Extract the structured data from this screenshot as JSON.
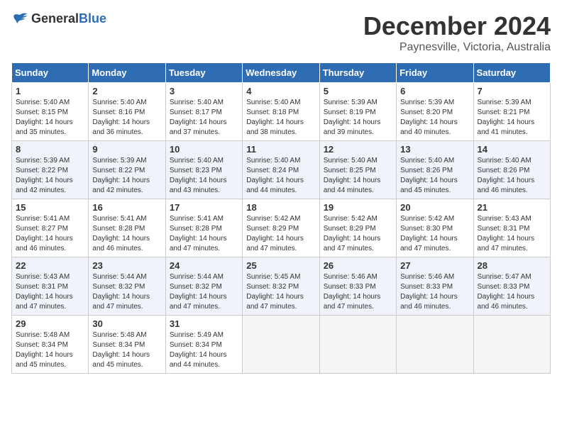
{
  "header": {
    "logo_general": "General",
    "logo_blue": "Blue",
    "month_title": "December 2024",
    "location": "Paynesville, Victoria, Australia"
  },
  "weekdays": [
    "Sunday",
    "Monday",
    "Tuesday",
    "Wednesday",
    "Thursday",
    "Friday",
    "Saturday"
  ],
  "weeks": [
    [
      {
        "day": "1",
        "sunrise": "5:40 AM",
        "sunset": "8:15 PM",
        "daylight": "14 hours and 35 minutes."
      },
      {
        "day": "2",
        "sunrise": "5:40 AM",
        "sunset": "8:16 PM",
        "daylight": "14 hours and 36 minutes."
      },
      {
        "day": "3",
        "sunrise": "5:40 AM",
        "sunset": "8:17 PM",
        "daylight": "14 hours and 37 minutes."
      },
      {
        "day": "4",
        "sunrise": "5:40 AM",
        "sunset": "8:18 PM",
        "daylight": "14 hours and 38 minutes."
      },
      {
        "day": "5",
        "sunrise": "5:39 AM",
        "sunset": "8:19 PM",
        "daylight": "14 hours and 39 minutes."
      },
      {
        "day": "6",
        "sunrise": "5:39 AM",
        "sunset": "8:20 PM",
        "daylight": "14 hours and 40 minutes."
      },
      {
        "day": "7",
        "sunrise": "5:39 AM",
        "sunset": "8:21 PM",
        "daylight": "14 hours and 41 minutes."
      }
    ],
    [
      {
        "day": "8",
        "sunrise": "5:39 AM",
        "sunset": "8:22 PM",
        "daylight": "14 hours and 42 minutes."
      },
      {
        "day": "9",
        "sunrise": "5:39 AM",
        "sunset": "8:22 PM",
        "daylight": "14 hours and 42 minutes."
      },
      {
        "day": "10",
        "sunrise": "5:40 AM",
        "sunset": "8:23 PM",
        "daylight": "14 hours and 43 minutes."
      },
      {
        "day": "11",
        "sunrise": "5:40 AM",
        "sunset": "8:24 PM",
        "daylight": "14 hours and 44 minutes."
      },
      {
        "day": "12",
        "sunrise": "5:40 AM",
        "sunset": "8:25 PM",
        "daylight": "14 hours and 44 minutes."
      },
      {
        "day": "13",
        "sunrise": "5:40 AM",
        "sunset": "8:26 PM",
        "daylight": "14 hours and 45 minutes."
      },
      {
        "day": "14",
        "sunrise": "5:40 AM",
        "sunset": "8:26 PM",
        "daylight": "14 hours and 46 minutes."
      }
    ],
    [
      {
        "day": "15",
        "sunrise": "5:41 AM",
        "sunset": "8:27 PM",
        "daylight": "14 hours and 46 minutes."
      },
      {
        "day": "16",
        "sunrise": "5:41 AM",
        "sunset": "8:28 PM",
        "daylight": "14 hours and 46 minutes."
      },
      {
        "day": "17",
        "sunrise": "5:41 AM",
        "sunset": "8:28 PM",
        "daylight": "14 hours and 47 minutes."
      },
      {
        "day": "18",
        "sunrise": "5:42 AM",
        "sunset": "8:29 PM",
        "daylight": "14 hours and 47 minutes."
      },
      {
        "day": "19",
        "sunrise": "5:42 AM",
        "sunset": "8:29 PM",
        "daylight": "14 hours and 47 minutes."
      },
      {
        "day": "20",
        "sunrise": "5:42 AM",
        "sunset": "8:30 PM",
        "daylight": "14 hours and 47 minutes."
      },
      {
        "day": "21",
        "sunrise": "5:43 AM",
        "sunset": "8:31 PM",
        "daylight": "14 hours and 47 minutes."
      }
    ],
    [
      {
        "day": "22",
        "sunrise": "5:43 AM",
        "sunset": "8:31 PM",
        "daylight": "14 hours and 47 minutes."
      },
      {
        "day": "23",
        "sunrise": "5:44 AM",
        "sunset": "8:32 PM",
        "daylight": "14 hours and 47 minutes."
      },
      {
        "day": "24",
        "sunrise": "5:44 AM",
        "sunset": "8:32 PM",
        "daylight": "14 hours and 47 minutes."
      },
      {
        "day": "25",
        "sunrise": "5:45 AM",
        "sunset": "8:32 PM",
        "daylight": "14 hours and 47 minutes."
      },
      {
        "day": "26",
        "sunrise": "5:46 AM",
        "sunset": "8:33 PM",
        "daylight": "14 hours and 47 minutes."
      },
      {
        "day": "27",
        "sunrise": "5:46 AM",
        "sunset": "8:33 PM",
        "daylight": "14 hours and 46 minutes."
      },
      {
        "day": "28",
        "sunrise": "5:47 AM",
        "sunset": "8:33 PM",
        "daylight": "14 hours and 46 minutes."
      }
    ],
    [
      {
        "day": "29",
        "sunrise": "5:48 AM",
        "sunset": "8:34 PM",
        "daylight": "14 hours and 45 minutes."
      },
      {
        "day": "30",
        "sunrise": "5:48 AM",
        "sunset": "8:34 PM",
        "daylight": "14 hours and 45 minutes."
      },
      {
        "day": "31",
        "sunrise": "5:49 AM",
        "sunset": "8:34 PM",
        "daylight": "14 hours and 44 minutes."
      },
      null,
      null,
      null,
      null
    ]
  ]
}
